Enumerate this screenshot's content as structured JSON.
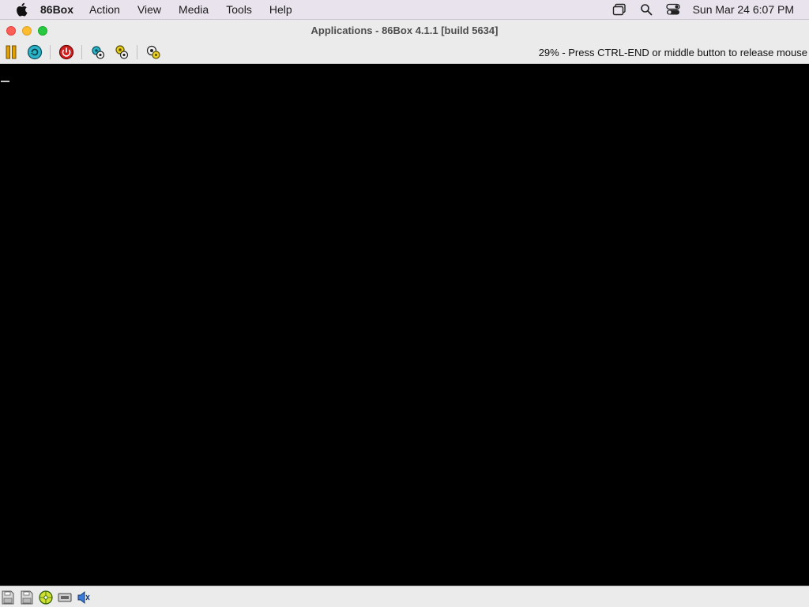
{
  "menubar": {
    "app_name": "86Box",
    "items": [
      "Action",
      "View",
      "Media",
      "Tools",
      "Help"
    ],
    "clock": "Sun Mar 24  6:07 PM",
    "icons": [
      "apple-icon",
      "window-switcher-icon",
      "spotlight-search-icon",
      "control-center-icon"
    ]
  },
  "window": {
    "title": "Applications - 86Box 4.1.1 [build 5634]",
    "status_message": "29% - Press CTRL-END or middle button to release mouse"
  },
  "toolbar": {
    "buttons": [
      "pause-icon",
      "reset-icon",
      "power-icon",
      "settings-icon",
      "hard-reset-icon",
      "config-icon"
    ]
  },
  "statusbar": {
    "icons": [
      "floppy-drive-1-icon",
      "floppy-drive-2-icon",
      "cdrom-icon",
      "network-icon",
      "sound-icon"
    ]
  },
  "colors": {
    "menubar_bg": "#e8e3ec",
    "toolbar_bg": "#ebebeb",
    "screen_bg": "#000000",
    "traffic_close": "#fe5f57",
    "traffic_min": "#febc2e",
    "traffic_max": "#28c840"
  }
}
